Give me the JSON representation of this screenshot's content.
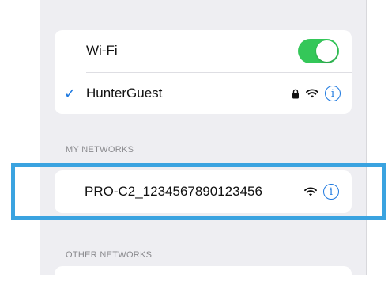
{
  "wifi": {
    "label": "Wi-Fi",
    "enabled": true,
    "toggle_color": "#34c759"
  },
  "connected_network": {
    "name": "HunterGuest",
    "checkmark": "✓",
    "icons": [
      "lock-icon",
      "wifi-signal-icon",
      "info-icon"
    ],
    "info_glyph": "i"
  },
  "sections": {
    "my_networks": "MY NETWORKS",
    "other_networks": "OTHER NETWORKS"
  },
  "my_networks": [
    {
      "name": "PRO-C2_1234567890123456",
      "icons": [
        "wifi-signal-icon",
        "info-icon"
      ],
      "info_glyph": "i"
    }
  ],
  "accent_color": "#1f7ae0",
  "highlight_color": "#3aa3e0"
}
